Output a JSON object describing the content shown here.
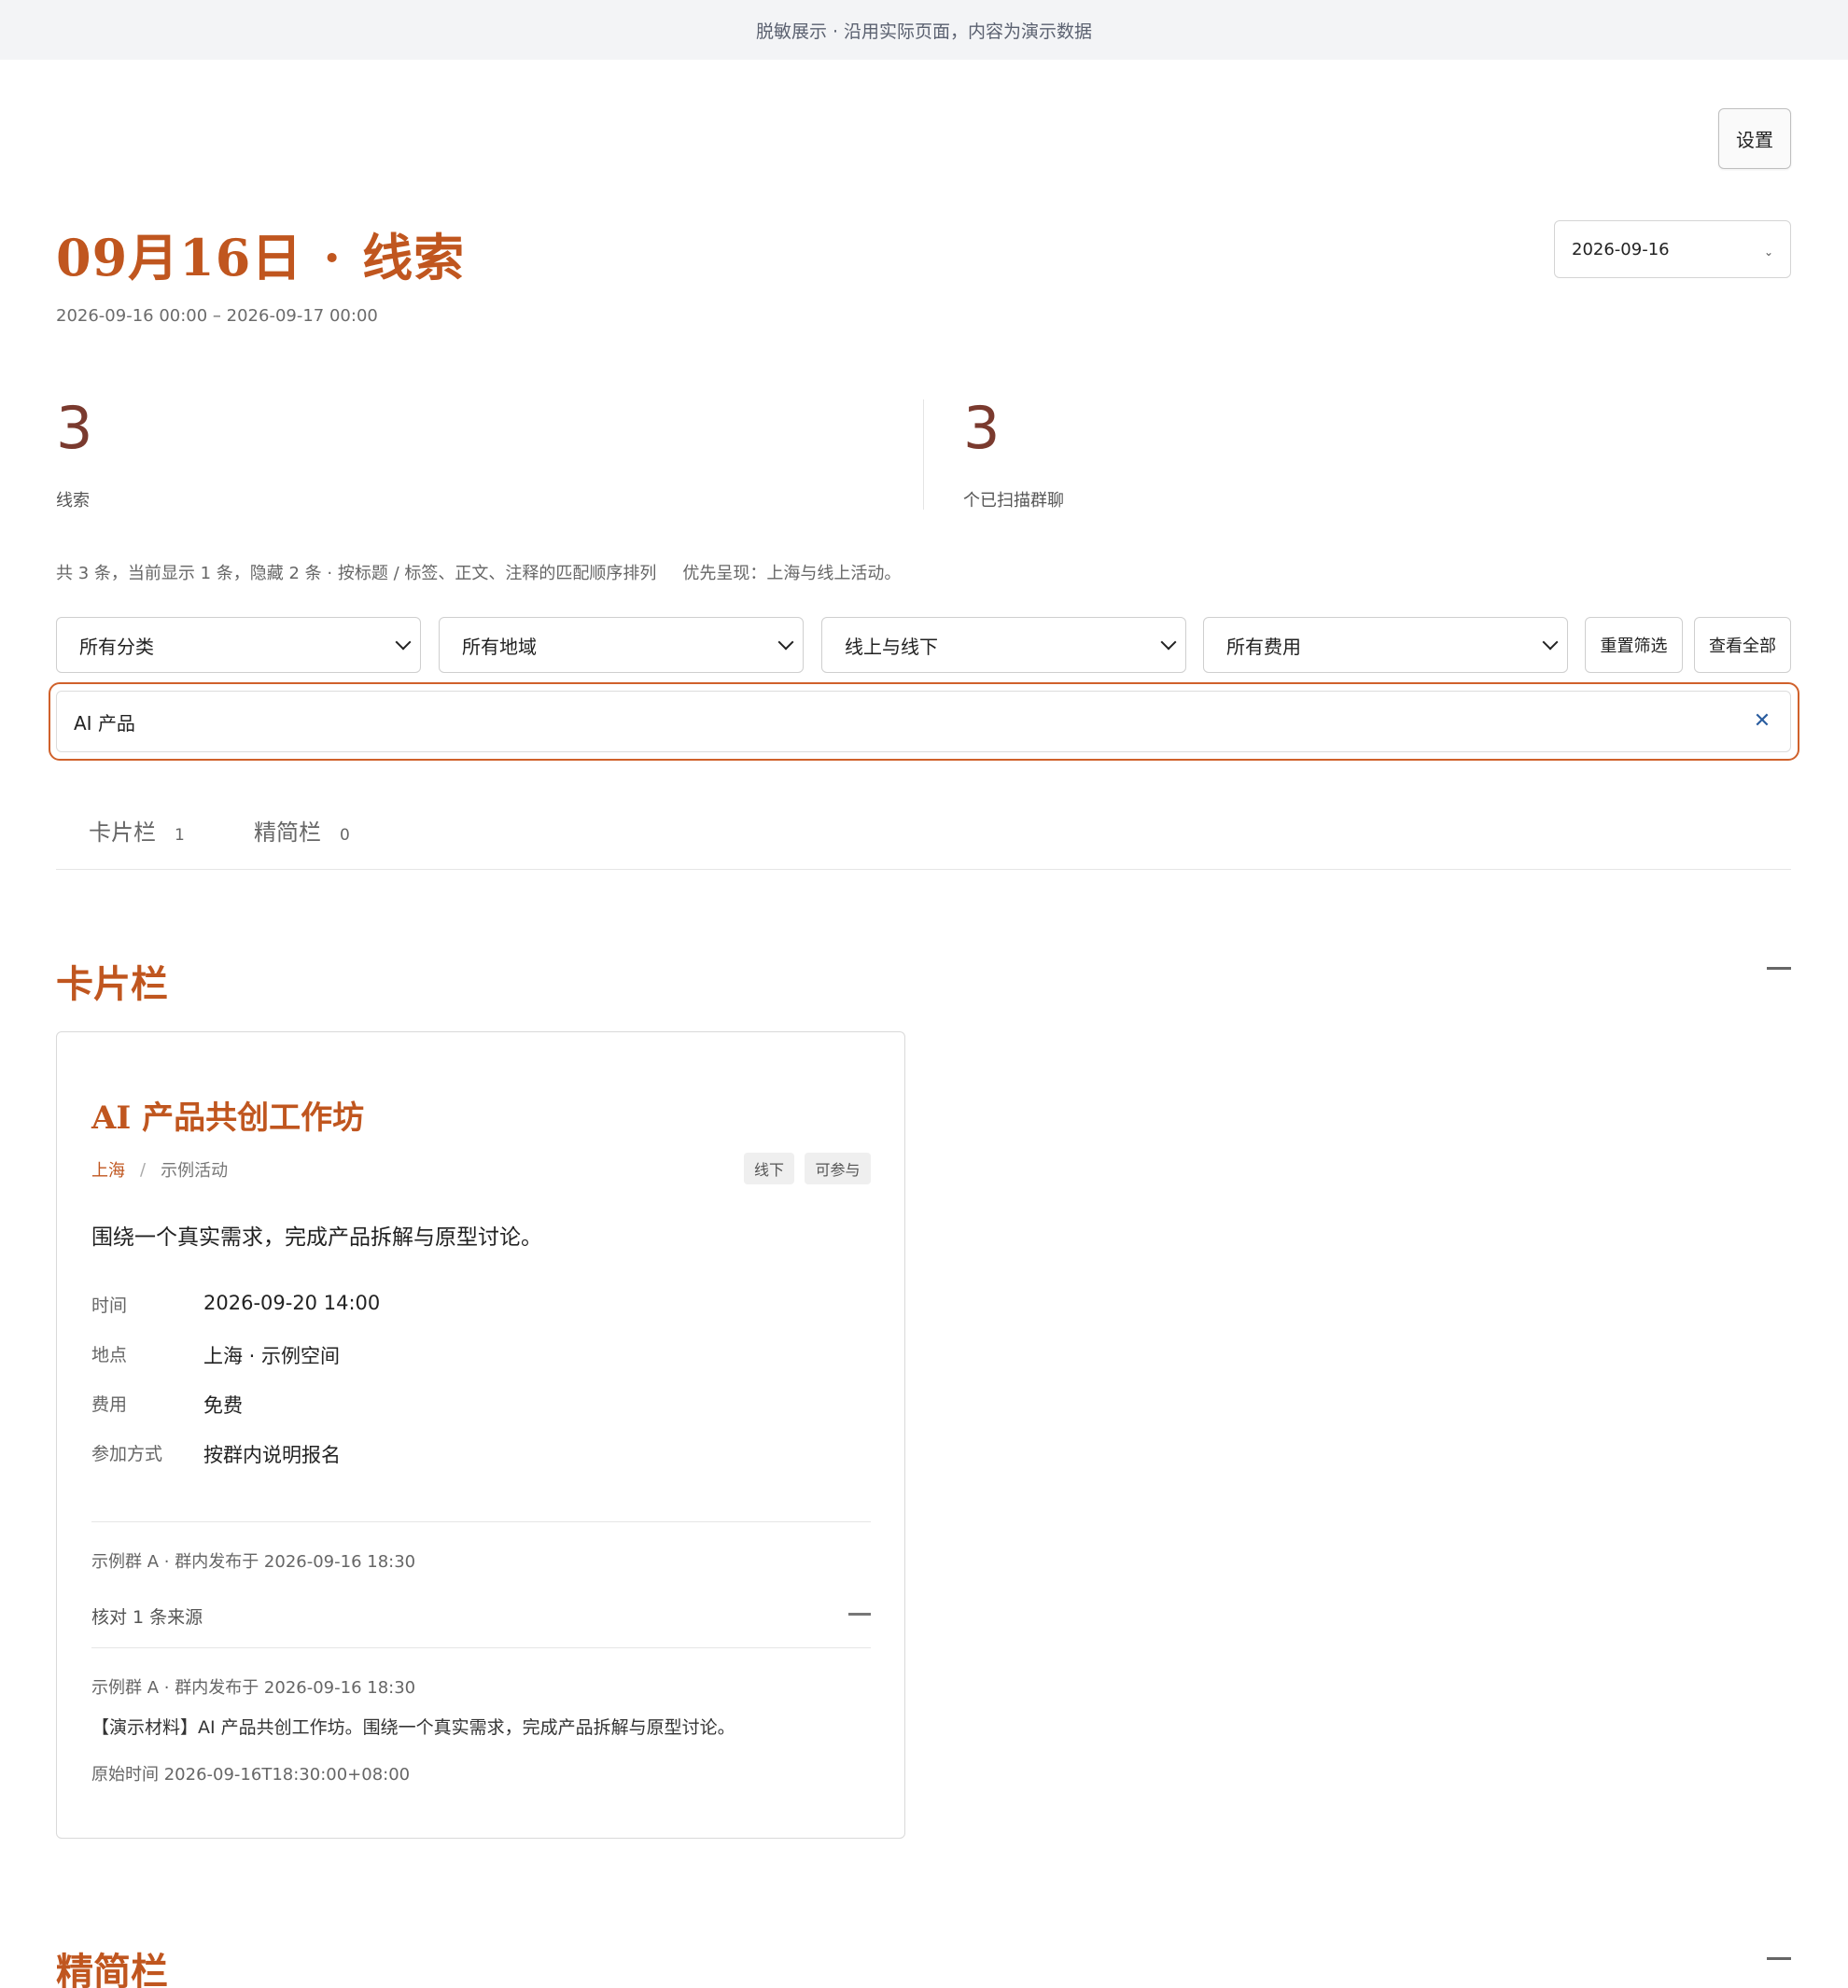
{
  "banner": {
    "text": "脱敏展示 · 沿用实际页面，内容为演示数据"
  },
  "header": {
    "settings_label": "设置",
    "title_date": "09月16日",
    "title_dot": "·",
    "title_section": "线索",
    "range": "2026-09-16 00:00 – 2026-09-17 00:00",
    "date_value": "2026-09-16"
  },
  "stats": [
    {
      "value": "3",
      "label": "线索"
    },
    {
      "value": "3",
      "label": "个已扫描群聊"
    }
  ],
  "summary": {
    "text": "共 3 条，当前显示 1 条，隐藏 2 条 · 按标题 / 标签、正文、注释的匹配顺序排列",
    "priority": "优先呈现：上海与线上活动。"
  },
  "filters": {
    "category": "所有分类",
    "region": "所有地域",
    "mode": "线上与线下",
    "fee": "所有费用",
    "reset_label": "重置筛选",
    "view_all_label": "查看全部"
  },
  "search": {
    "value": "AI 产品",
    "clear_icon": "✕"
  },
  "tabs": [
    {
      "label": "卡片栏",
      "count": "1"
    },
    {
      "label": "精简栏",
      "count": "0"
    }
  ],
  "sections": {
    "cards_title": "卡片栏",
    "compact_title": "精简栏"
  },
  "card": {
    "title": "AI 产品共创工作坊",
    "city": "上海",
    "sep": "/",
    "category": "示例活动",
    "tags": [
      "线下",
      "可参与"
    ],
    "description": "围绕一个真实需求，完成产品拆解与原型讨论。",
    "fields": [
      {
        "k": "时间",
        "v": "2026-09-20 14:00"
      },
      {
        "k": "地点",
        "v": "上海 · 示例空间"
      },
      {
        "k": "费用",
        "v": "免费"
      },
      {
        "k": "参加方式",
        "v": "按群内说明报名"
      }
    ],
    "posted": "示例群 A · 群内发布于 2026-09-16 18:30",
    "verify_label": "核对 1 条来源",
    "source_posted": "示例群 A · 群内发布于 2026-09-16 18:30",
    "source_text": "【演示材料】AI 产品共创工作坊。围绕一个真实需求，完成产品拆解与原型讨论。",
    "source_time": "原始时间 2026-09-16T18:30:00+08:00"
  }
}
